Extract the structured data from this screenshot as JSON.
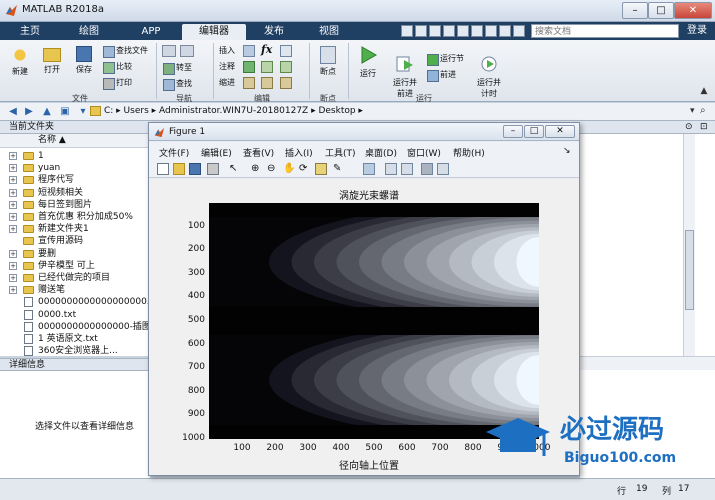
{
  "window": {
    "title": "MATLAB R2018a"
  },
  "tabs": [
    {
      "label": "主页"
    },
    {
      "label": "绘图"
    },
    {
      "label": "APP"
    },
    {
      "label": "编辑器"
    },
    {
      "label": "发布"
    },
    {
      "label": "视图"
    }
  ],
  "search": {
    "placeholder": "搜索文档"
  },
  "login": "登录",
  "ribbon": {
    "file": {
      "group": "文件",
      "new": "新建",
      "open": "打开",
      "save": "保存",
      "find_files": "查找文件",
      "compare": "比较",
      "print": "打印"
    },
    "navigate": {
      "group": "导航",
      "goto": "转至",
      "find": "查找"
    },
    "edit": {
      "group": "编辑",
      "insert": "插入",
      "comment": "注释",
      "indent": "缩进",
      "fx": "fx"
    },
    "breakpoints": {
      "group": "断点",
      "breakpoints": "断点"
    },
    "run": {
      "group": "运行",
      "run": "运行",
      "run_advance": "运行并\n前进",
      "run_section": "运行节",
      "advance": "前进",
      "run_time": "运行并\n计时"
    }
  },
  "address": {
    "path": "C: ▸ Users ▸ Administrator.WIN7U-20180127Z ▸ Desktop ▸"
  },
  "current_folder": {
    "header": "当前文件夹",
    "column": "名称 ▲",
    "items": [
      {
        "kind": "folder",
        "expand": "+",
        "name": "1"
      },
      {
        "kind": "folder",
        "expand": "+",
        "name": "yuan"
      },
      {
        "kind": "folder",
        "expand": "+",
        "name": "程序代写"
      },
      {
        "kind": "folder",
        "expand": "+",
        "name": "短视频相关"
      },
      {
        "kind": "folder",
        "expand": "+",
        "name": "每日签到图片"
      },
      {
        "kind": "folder",
        "expand": "+",
        "name": "首充优惠 积分加成50%"
      },
      {
        "kind": "folder",
        "expand": "+",
        "name": "新建文件夹1"
      },
      {
        "kind": "folder",
        "expand": "",
        "name": "宣传用源码"
      },
      {
        "kind": "folder",
        "expand": "+",
        "name": "要删"
      },
      {
        "kind": "folder",
        "expand": "+",
        "name": "伊辛模型 可上"
      },
      {
        "kind": "folder",
        "expand": "+",
        "name": "已经代做完的项目"
      },
      {
        "kind": "folder",
        "expand": "+",
        "name": "赠送笔"
      },
      {
        "kind": "file",
        "expand": "",
        "name": "0000000000000000000..."
      },
      {
        "kind": "file",
        "expand": "",
        "name": "0000.txt"
      },
      {
        "kind": "file",
        "expand": "",
        "name": "0000000000000000-插图L..."
      },
      {
        "kind": "file",
        "expand": "",
        "name": "1 英语原文.txt"
      },
      {
        "kind": "file",
        "expand": "",
        "name": "360安全浏览器上..."
      }
    ]
  },
  "details": {
    "header": "详细信息",
    "message": "选择文件以查看详细信息"
  },
  "status": {
    "row_label": "行",
    "row": "19",
    "col_label": "列",
    "col": "17"
  },
  "figure": {
    "title": "Figure 1",
    "menu": [
      "文件(F)",
      "编辑(E)",
      "查看(V)",
      "插入(I)",
      "工具(T)",
      "桌面(D)",
      "窗口(W)",
      "帮助(H)"
    ]
  },
  "chart_data": {
    "type": "heatmap",
    "title": "涡旋光束螺谱",
    "xlabel": "径向轴上位置",
    "ylabel": "",
    "x_ticks": [
      100,
      200,
      300,
      400,
      500,
      600,
      700,
      800,
      900,
      1000
    ],
    "y_ticks": [
      100,
      200,
      300,
      400,
      500,
      600,
      700,
      800,
      900,
      1000
    ],
    "xlim": [
      0,
      1000
    ],
    "ylim": [
      0,
      1000
    ],
    "y_reversed": true,
    "colormap": "bone",
    "bright_centers": [
      {
        "x": 1000,
        "y": 250
      },
      {
        "x": 1000,
        "y": 750
      }
    ],
    "dark_bands_y": [
      0,
      500,
      1000
    ]
  },
  "watermark": {
    "text": "必过源码",
    "subtext": "Biguo100.com"
  },
  "colors": {
    "tabbar": "#1f3f63",
    "ribbon": "#eef2f6",
    "accent": "#2a63a8"
  }
}
